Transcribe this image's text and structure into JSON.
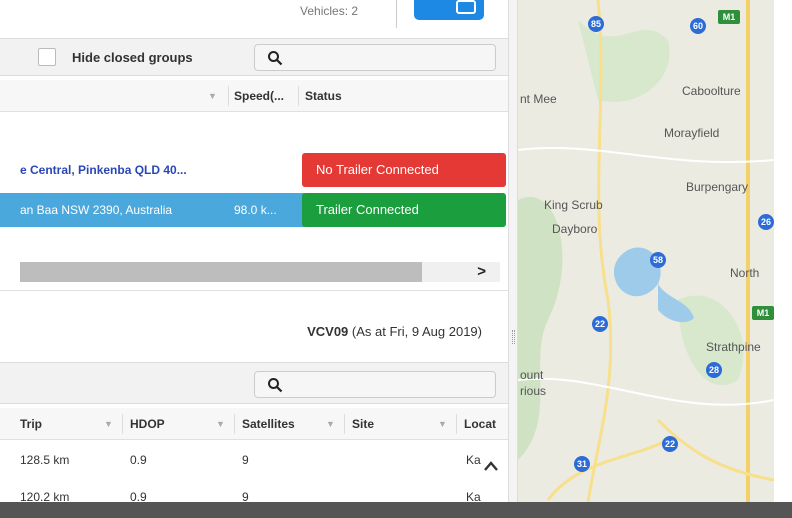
{
  "topbar": {
    "vehicles_text": "Vehicles: 2"
  },
  "groups_panel": {
    "hide_closed_label": "Hide closed groups",
    "columns": [
      "Speed(...",
      "Status"
    ],
    "rows": [
      {
        "location": "e Central, Pinkenba QLD 40...",
        "speed": "",
        "status": "No Trailer Connected",
        "status_color": "#e53935"
      },
      {
        "location": "an Baa NSW 2390, Australia",
        "speed": "98.0 k...",
        "status": "Trailer Connected",
        "status_color": "#1b9e3e",
        "selected": true
      }
    ]
  },
  "detail": {
    "vehicle": "VCV09",
    "as_at": "(As at Fri, 9 Aug 2019)",
    "columns": [
      "Trip",
      "HDOP",
      "Satellites",
      "Site",
      "Locat"
    ],
    "rows": [
      {
        "trip": "128.5 km",
        "hdop": "0.9",
        "satellites": "9",
        "site": "",
        "location": "Ka"
      },
      {
        "trip": "120.2 km",
        "hdop": "0.9",
        "satellites": "9",
        "site": "",
        "location": "Ka"
      }
    ]
  },
  "map": {
    "places": [
      "nt Mee",
      "Caboolture",
      "Morayfield",
      "Burpengary",
      "King Scrub",
      "Dayboro",
      "North",
      "Strathpine",
      "ount",
      "rious"
    ],
    "shields": [
      "85",
      "60",
      "M1",
      "58",
      "22",
      "M1",
      "28",
      "22",
      "31",
      "26"
    ]
  },
  "colors": {
    "accent": "#1e88e5",
    "selected_row": "#4aa8dd",
    "status_red": "#e53935",
    "status_green": "#1b9e3e"
  }
}
